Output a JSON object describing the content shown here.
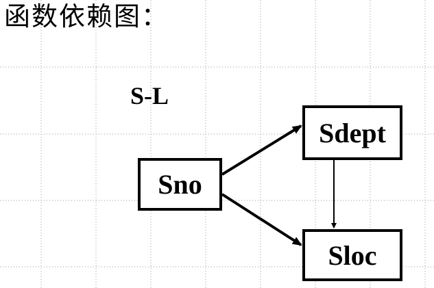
{
  "title": "函数依赖图：",
  "relation_name": "S-L",
  "nodes": {
    "sno": "Sno",
    "sdept": "Sdept",
    "sloc": "Sloc"
  },
  "colors": {
    "background": "#ffffff",
    "ink": "#000000",
    "grid": "#9a9a9a"
  }
}
